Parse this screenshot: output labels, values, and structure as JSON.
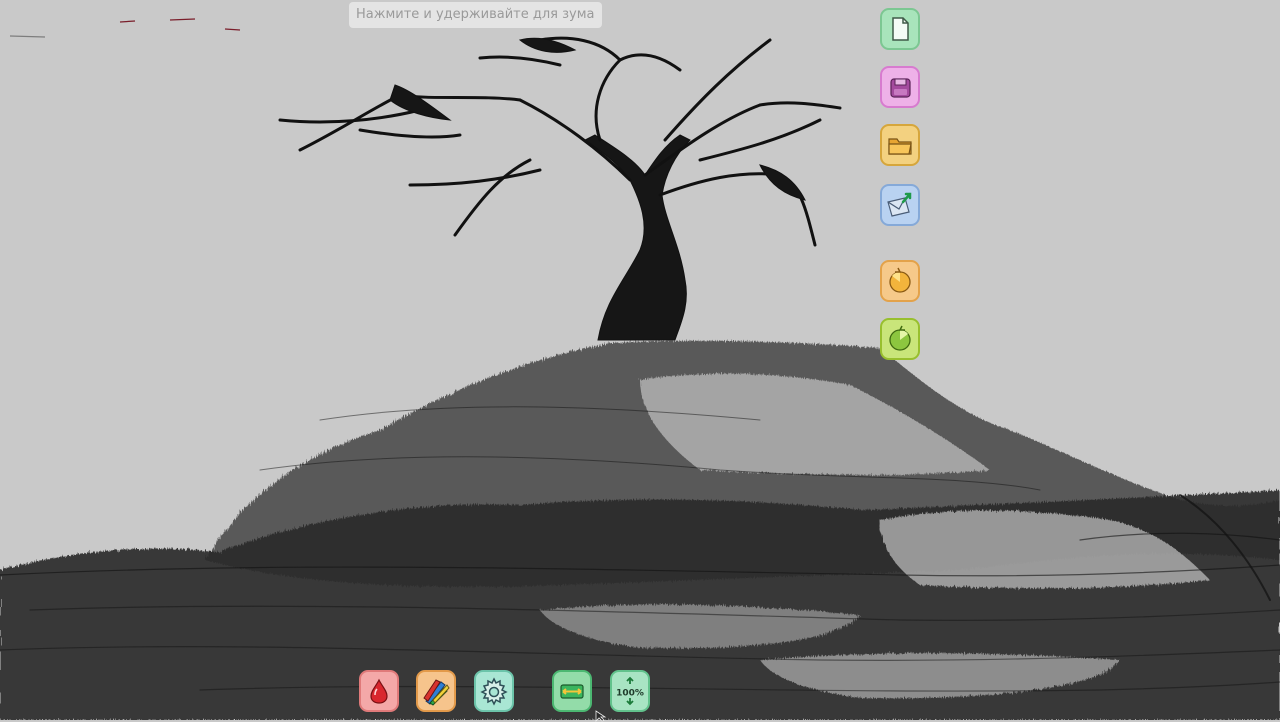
{
  "hint": {
    "text": "Нажмите и удерживайте для зума"
  },
  "side_toolbar": [
    {
      "name": "new-file-button",
      "icon": "new-file-icon",
      "color": "#8fd9a8"
    },
    {
      "name": "save-button",
      "icon": "save-disk-icon",
      "color": "#e79ae0"
    },
    {
      "name": "open-folder-button",
      "icon": "folder-icon",
      "color": "#f0c258"
    },
    {
      "name": "share-email-button",
      "icon": "envelope-send-icon",
      "color": "#9fc0ea"
    },
    {
      "name": "undo-button",
      "icon": "undo-icon",
      "color": "#f2b45c"
    },
    {
      "name": "redo-button",
      "icon": "redo-icon",
      "color": "#b6d84a"
    }
  ],
  "bottom_toolbar": [
    {
      "name": "color-picker-button",
      "icon": "drop-icon",
      "color": "#f18d8d"
    },
    {
      "name": "brushes-button",
      "icon": "pencils-icon",
      "color": "#f2a95c"
    },
    {
      "name": "settings-button",
      "icon": "gear-icon",
      "color": "#8fd9c3"
    },
    {
      "name": "fit-screen-button",
      "icon": "fit-icon",
      "color": "#7bd69a"
    },
    {
      "name": "zoom-100-button",
      "icon": "zoom-100-icon",
      "color": "#8fd9b0",
      "label": "100%"
    }
  ]
}
